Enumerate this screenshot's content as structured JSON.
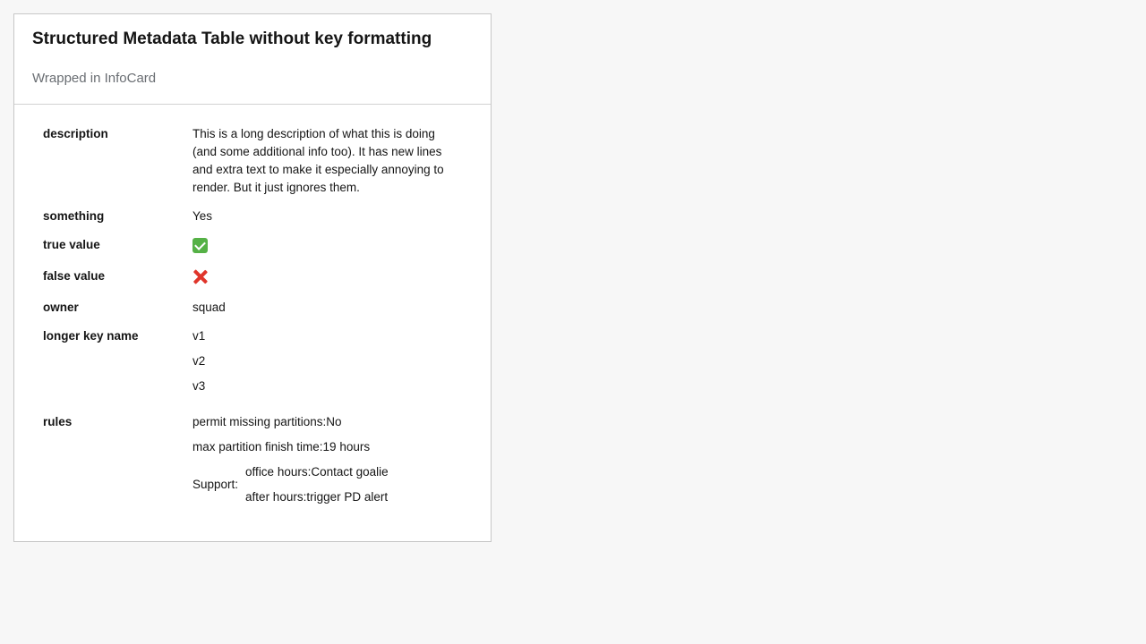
{
  "card": {
    "title": "Structured Metadata Table without key formatting",
    "subtitle": "Wrapped in InfoCard"
  },
  "rows": {
    "description": {
      "key": "description",
      "value": "This is a long description of what this is doing (and some additional info too). It has new lines and extra text to make it especially annoying to render. But it just ignores them."
    },
    "something": {
      "key": "something",
      "value": "Yes"
    },
    "true_value": {
      "key": "true value",
      "icon": "check-mark-icon",
      "color": "#55b146"
    },
    "false_value": {
      "key": "false value",
      "icon": "cross-mark-icon",
      "color": "#e0352b"
    },
    "owner": {
      "key": "owner",
      "value": "squad"
    },
    "longer_key_name": {
      "key": "longer key name",
      "values": [
        "v1",
        "v2",
        "v3"
      ]
    },
    "rules": {
      "key": "rules",
      "permit_missing_partitions": "permit missing partitions:No",
      "max_partition_finish_time": "max partition finish time:19 hours",
      "support_label": "Support:",
      "support_items": [
        "office hours:Contact goalie",
        "after hours:trigger PD alert"
      ]
    }
  }
}
